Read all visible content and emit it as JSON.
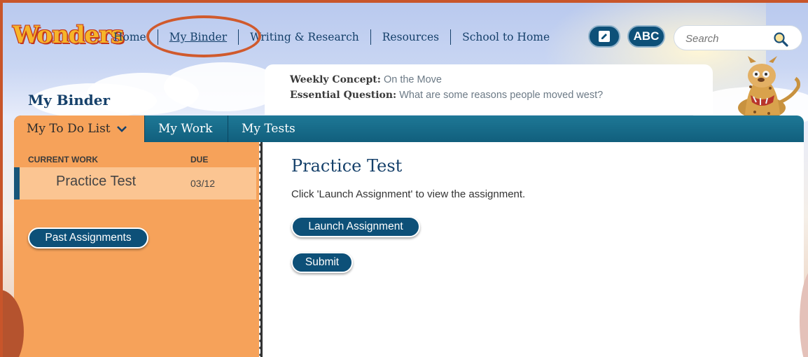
{
  "header": {
    "logo_text": "Wonders",
    "nav": [
      {
        "label": "Home",
        "active": false
      },
      {
        "label": "My Binder",
        "active": true
      },
      {
        "label": "Writing & Research",
        "active": false
      },
      {
        "label": "Resources",
        "active": false
      },
      {
        "label": "School to Home",
        "active": false
      }
    ],
    "abc_label": "ABC",
    "search_placeholder": "Search"
  },
  "page_title": "My Binder",
  "concept": {
    "weekly_label": "Weekly Concept:",
    "weekly_value": "On the Move",
    "question_label": "Essential Question:",
    "question_value": "What are some reasons people moved west?"
  },
  "tabs": [
    {
      "label": "My To Do List",
      "active": true,
      "icon": "chevron-down-icon"
    },
    {
      "label": "My Work",
      "active": false
    },
    {
      "label": "My Tests",
      "active": false
    }
  ],
  "todo": {
    "col_current": "CURRENT WORK",
    "col_due": "DUE",
    "items": [
      {
        "name": "Practice Test",
        "due": "03/12"
      }
    ],
    "past_button": "Past Assignments"
  },
  "assignment": {
    "title": "Practice Test",
    "instruction": "Click 'Launch Assignment' to view the assignment.",
    "launch_button": "Launch Assignment",
    "submit_button": "Submit"
  },
  "colors": {
    "brand_blue": "#0d5078",
    "tab_teal": "#115f7d",
    "orange_panel": "#f6a25a",
    "highlight_circle": "#d05a2d"
  }
}
